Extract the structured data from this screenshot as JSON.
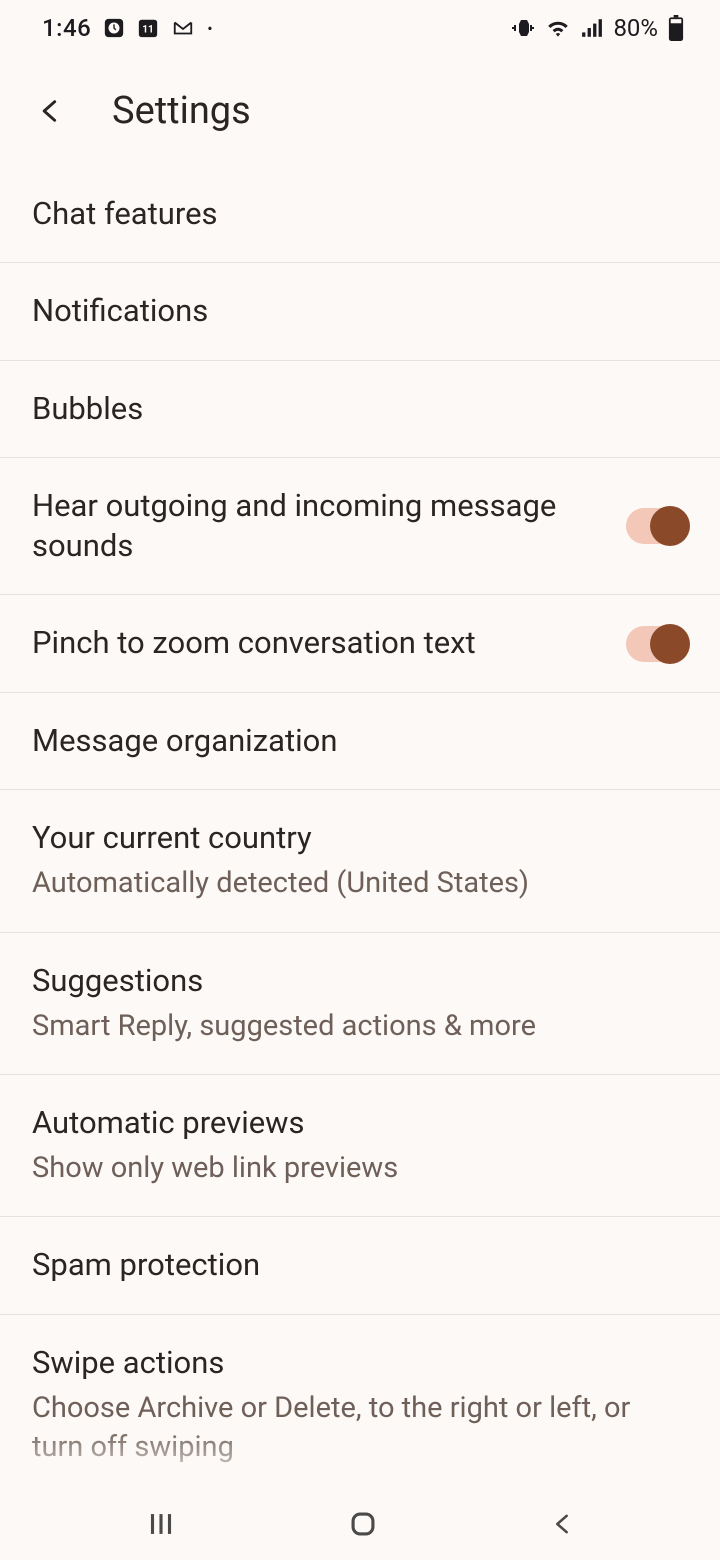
{
  "status": {
    "time": "1:46",
    "battery": "80%"
  },
  "header": {
    "title": "Settings"
  },
  "items": [
    {
      "title": "Chat features"
    },
    {
      "title": "Notifications"
    },
    {
      "title": "Bubbles"
    },
    {
      "title": "Hear outgoing and incoming message sounds",
      "toggle": true
    },
    {
      "title": "Pinch to zoom conversation text",
      "toggle": true
    },
    {
      "title": "Message organization"
    },
    {
      "title": "Your current country",
      "subtitle": "Automatically detected (United States)"
    },
    {
      "title": "Suggestions",
      "subtitle": "Smart Reply, suggested actions & more"
    },
    {
      "title": "Automatic previews",
      "subtitle": "Show only web link previews"
    },
    {
      "title": "Spam protection"
    },
    {
      "title": "Swipe actions",
      "subtitle": "Choose Archive or Delete, to the right or left, or turn off swiping"
    }
  ]
}
